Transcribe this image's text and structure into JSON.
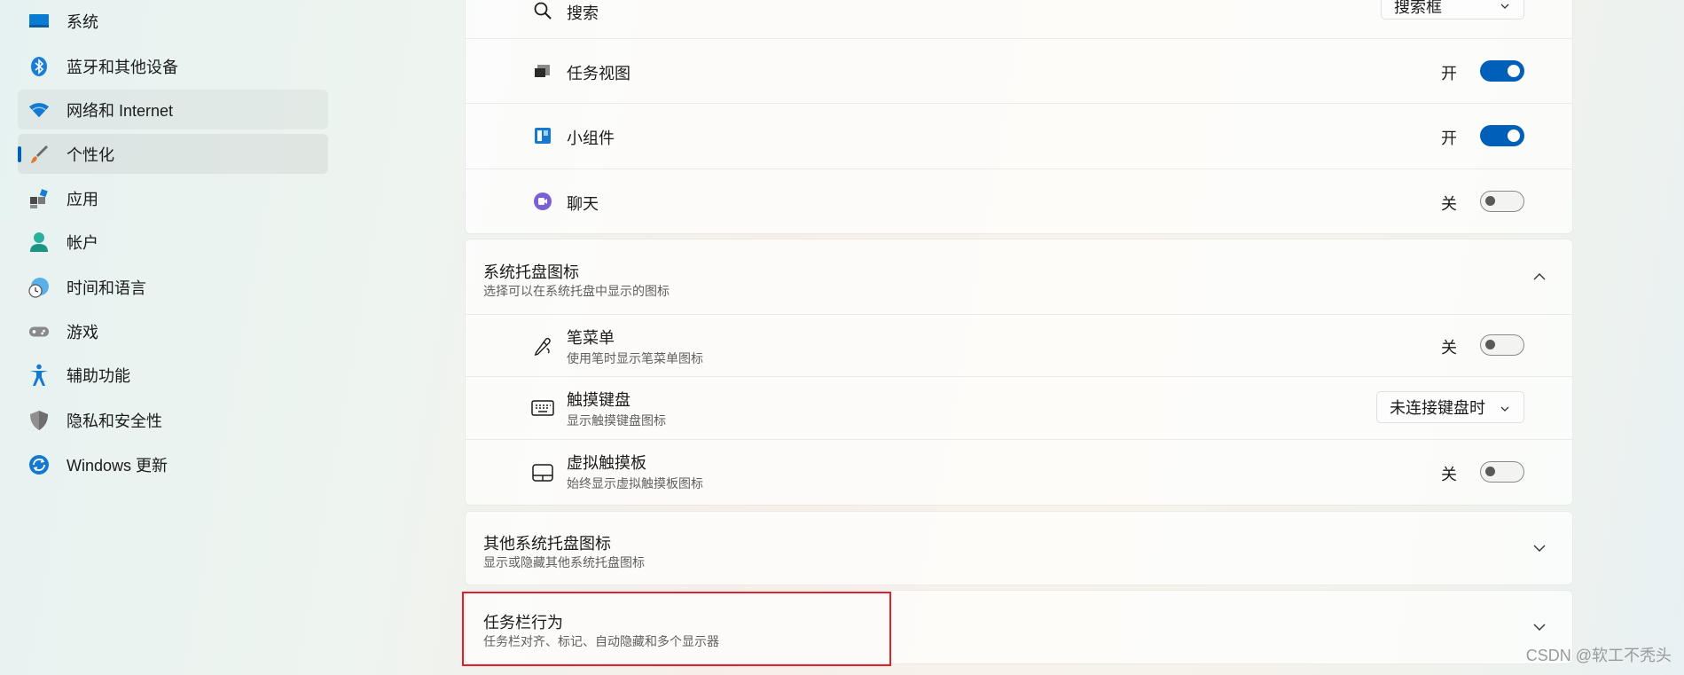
{
  "sidebar": {
    "items": [
      {
        "label": "系统",
        "icon": "system-icon"
      },
      {
        "label": "蓝牙和其他设备",
        "icon": "bluetooth-icon"
      },
      {
        "label": "网络和 Internet",
        "icon": "wifi-icon"
      },
      {
        "label": "个性化",
        "icon": "brush-icon"
      },
      {
        "label": "应用",
        "icon": "apps-icon"
      },
      {
        "label": "帐户",
        "icon": "account-icon"
      },
      {
        "label": "时间和语言",
        "icon": "clock-globe-icon"
      },
      {
        "label": "游戏",
        "icon": "gamepad-icon"
      },
      {
        "label": "辅助功能",
        "icon": "accessibility-icon"
      },
      {
        "label": "隐私和安全性",
        "icon": "shield-icon"
      },
      {
        "label": "Windows 更新",
        "icon": "update-icon"
      }
    ],
    "selected": "个性化"
  },
  "taskbar_items": {
    "search": {
      "label": "搜索",
      "value": "搜索框"
    },
    "task_view": {
      "label": "任务视图",
      "state": "开"
    },
    "widgets": {
      "label": "小组件",
      "state": "开"
    },
    "chat": {
      "label": "聊天",
      "state": "关"
    }
  },
  "tray_icons": {
    "title": "系统托盘图标",
    "subtitle": "选择可以在系统托盘中显示的图标",
    "pen_menu": {
      "title": "笔菜单",
      "subtitle": "使用笔时显示笔菜单图标",
      "state": "关"
    },
    "touch_keyboard": {
      "title": "触摸键盘",
      "subtitle": "显示触摸键盘图标",
      "value": "未连接键盘时"
    },
    "virtual_touchpad": {
      "title": "虚拟触摸板",
      "subtitle": "始终显示虚拟触摸板图标",
      "state": "关"
    }
  },
  "other_tray": {
    "title": "其他系统托盘图标",
    "subtitle": "显示或隐藏其他系统托盘图标"
  },
  "behaviors": {
    "title": "任务栏行为",
    "subtitle": "任务栏对齐、标记、自动隐藏和多个显示器"
  },
  "watermark": "CSDN @软工不秃头",
  "colors": {
    "accent": "#005fb8",
    "highlight": "#e0202a"
  }
}
